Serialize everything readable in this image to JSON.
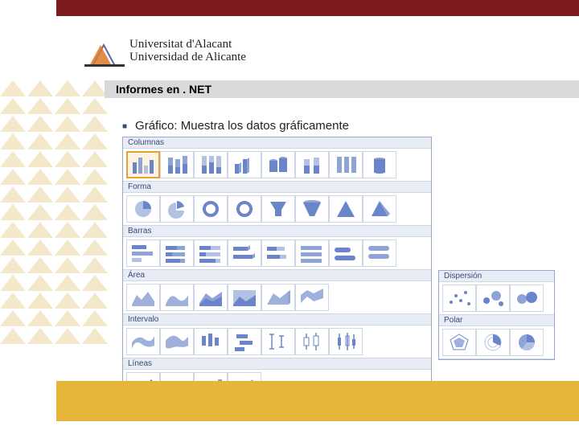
{
  "university": {
    "line1": "Universitat d'Alacant",
    "line2": "Universidad de Alicante"
  },
  "title": "Informes en . NET",
  "bullet": "Gráfico: Muestra los datos gráficamente",
  "gallery": {
    "sections": {
      "columnas": "Columnas",
      "forma": "Forma",
      "barras": "Barras",
      "area": "Área",
      "intervalo": "Intervalo",
      "lineas": "Líneas",
      "dispersion": "Dispersión",
      "polar": "Polar"
    }
  }
}
